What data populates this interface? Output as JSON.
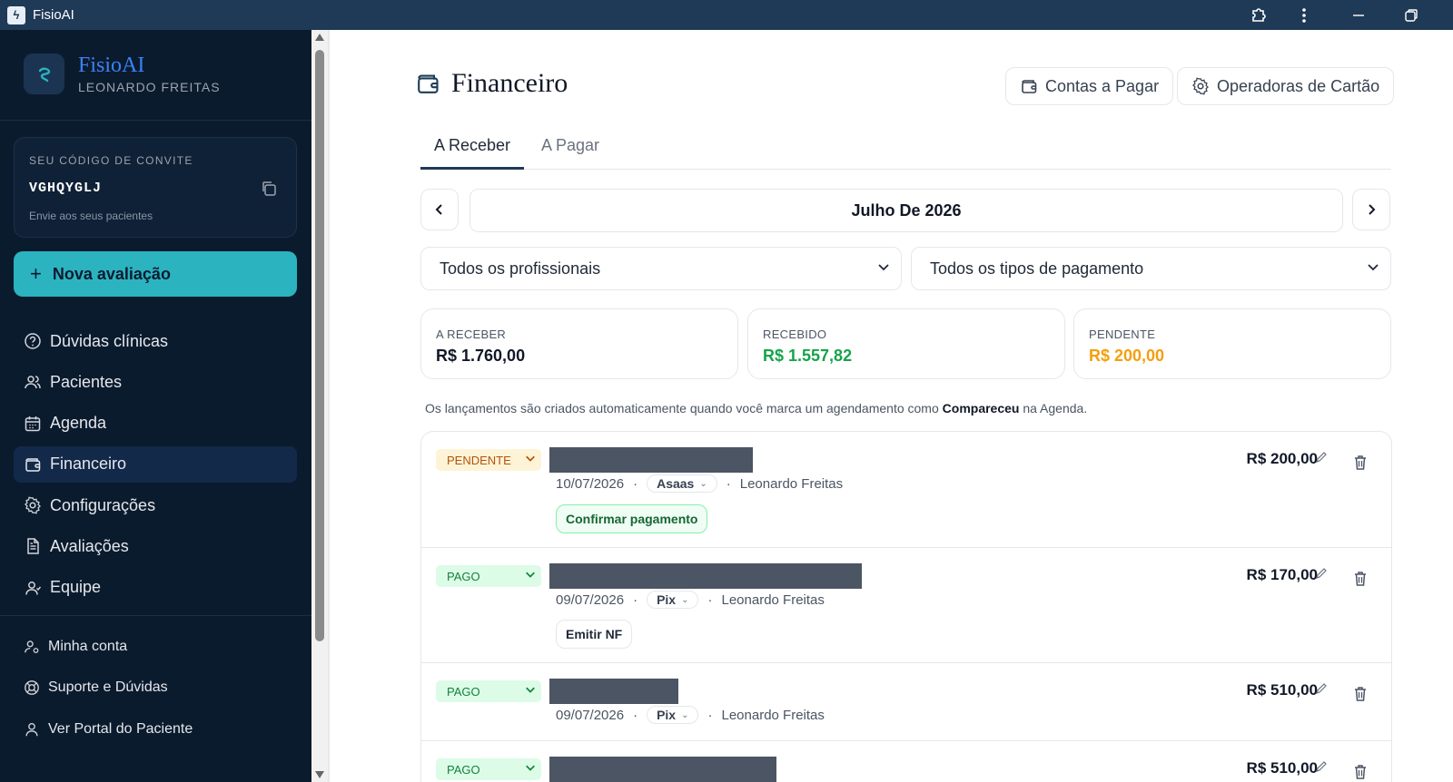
{
  "window": {
    "title": "FisioAI"
  },
  "sidebar": {
    "brand_name": "FisioAI",
    "user_name": "LEONARDO FREITAS",
    "invite": {
      "label": "SEU CÓDIGO DE CONVITE",
      "code": "VGHQYGLJ",
      "subtitle": "Envie aos seus pacientes"
    },
    "new_eval_label": "Nova avaliação",
    "items": [
      {
        "label": "Dúvidas clínicas",
        "icon": "help-circle-icon"
      },
      {
        "label": "Pacientes",
        "icon": "users-icon"
      },
      {
        "label": "Agenda",
        "icon": "calendar-icon"
      },
      {
        "label": "Financeiro",
        "icon": "wallet-icon",
        "active": true
      },
      {
        "label": "Configurações",
        "icon": "gear-icon"
      },
      {
        "label": "Avaliações",
        "icon": "document-icon"
      },
      {
        "label": "Equipe",
        "icon": "team-icon"
      }
    ],
    "secondary_items": [
      {
        "label": "Minha conta",
        "icon": "user-settings-icon"
      },
      {
        "label": "Suporte e Dúvidas",
        "icon": "lifebuoy-icon"
      },
      {
        "label": "Ver Portal do Paciente",
        "icon": "user-icon"
      }
    ]
  },
  "main": {
    "title": "Financeiro",
    "header_buttons": {
      "payables": "Contas a Pagar",
      "card_operators": "Operadoras de Cartão"
    },
    "tabs": [
      {
        "label": "A Receber",
        "active": true
      },
      {
        "label": "A Pagar",
        "active": false
      }
    ],
    "month_label": "Julho De 2026",
    "filters": {
      "professionals": "Todos os profissionais",
      "payment_types": "Todos os tipos de pagamento"
    },
    "summary": [
      {
        "label": "A RECEBER",
        "value": "R$ 1.760,00",
        "color": "#111827"
      },
      {
        "label": "RECEBIDO",
        "value": "R$ 1.557,82",
        "color": "#16a34a"
      },
      {
        "label": "PENDENTE",
        "value": "R$ 200,00",
        "color": "#f59e0b"
      }
    ],
    "info_text_before": "Os lançamentos são criados automaticamente quando você marca um agendamento como ",
    "info_text_bold": "Compareceu",
    "info_text_after": " na Agenda.",
    "entries": [
      {
        "status": "PENDENTE",
        "date": "10/07/2026",
        "method": "Asaas",
        "professional": "Leonardo Freitas",
        "amount": "R$ 200,00",
        "action": "Confirmar pagamento"
      },
      {
        "status": "PAGO",
        "date": "09/07/2026",
        "method": "Pix",
        "professional": "Leonardo Freitas",
        "amount": "R$ 170,00",
        "action": "Emitir NF"
      },
      {
        "status": "PAGO",
        "date": "09/07/2026",
        "method": "Pix",
        "professional": "Leonardo Freitas",
        "amount": "R$ 510,00"
      },
      {
        "status": "PAGO",
        "amount": "R$ 510,00"
      }
    ],
    "separator": "·"
  }
}
